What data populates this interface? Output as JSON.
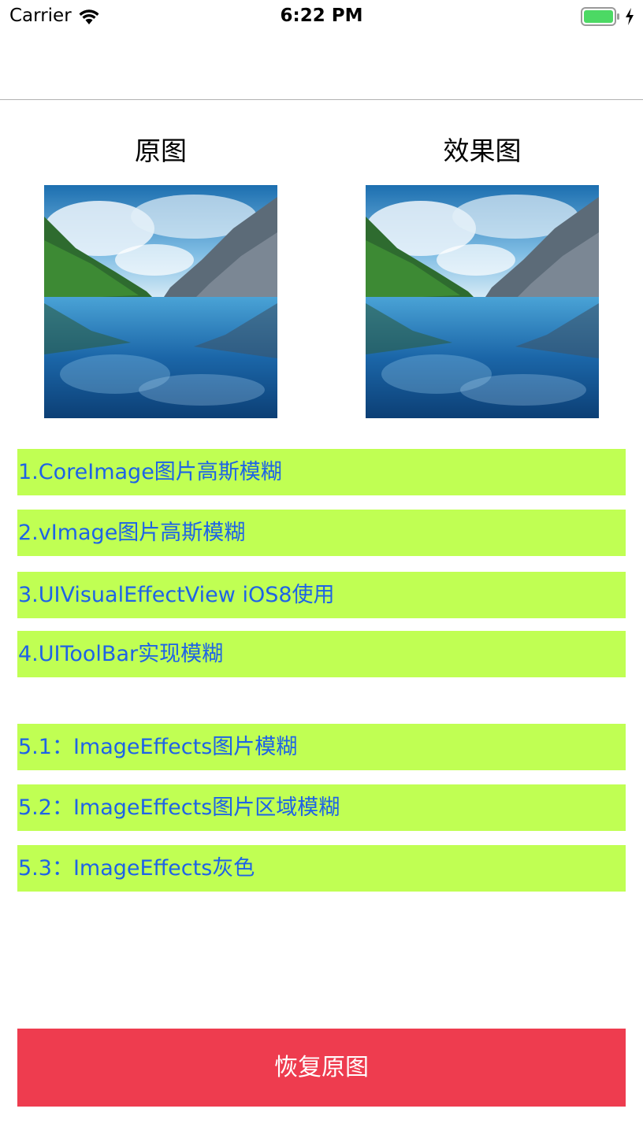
{
  "status_bar": {
    "carrier": "Carrier",
    "time": "6:22 PM",
    "battery_color": "#4cd964"
  },
  "titles": {
    "original": "原图",
    "effect": "效果图"
  },
  "images": {
    "original_icon": "landscape-lake-image",
    "effect_icon": "landscape-lake-image"
  },
  "buttons": [
    {
      "label": "1.CoreImage图片高斯模糊"
    },
    {
      "label": "2.vImage图片高斯模糊"
    },
    {
      "label": "3.UIVisualEffectView iOS8使用"
    },
    {
      "label": "4.UIToolBar实现模糊"
    },
    {
      "label": "5.1：ImageEffects图片模糊"
    },
    {
      "label": "5.2：ImageEffects图片区域模糊"
    },
    {
      "label": "5.3：ImageEffects灰色"
    }
  ],
  "restore": {
    "label": "恢复原图"
  },
  "colors": {
    "button_bg": "#c0ff53",
    "button_text": "#1e63e6",
    "restore_bg": "#ee3c4f"
  }
}
